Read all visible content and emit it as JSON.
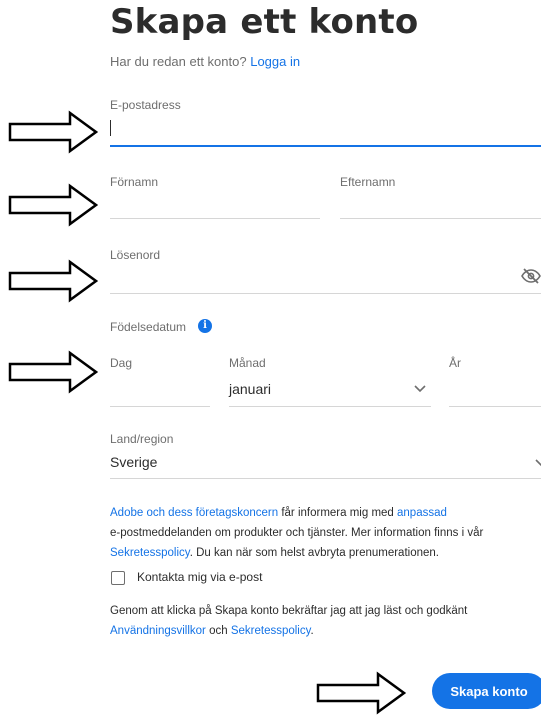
{
  "header": {
    "title": "Skapa ett konto",
    "has_account_text": "Har du redan ett konto?",
    "login_link": "Logga in"
  },
  "form": {
    "email_label": "E-postadress",
    "email_value": "",
    "first_name_label": "Förnamn",
    "last_name_label": "Efternamn",
    "password_label": "Lösenord",
    "birthdate_label": "Födelsedatum",
    "info_icon": "i",
    "day_label": "Dag",
    "month_label": "Månad",
    "month_value": "januari",
    "year_label": "År",
    "country_label": "Land/region",
    "country_value": "Sverige"
  },
  "consent": {
    "part1_link": "Adobe och dess företagskoncern",
    "part2_text": " får informera mig med ",
    "part3_link": "anpassad",
    "line2_text": "e-postmeddelanden om produkter och tjänster. Mer information finns i vår",
    "privacy_link": "Sekretesspolicy",
    "line3_text": ". Du kan när som helst avbryta prenumerationen.",
    "checkbox_label": "Kontakta mig via e-post",
    "terms_text": "Genom att klicka på Skapa konto bekräftar jag att jag läst och godkänt",
    "terms_link": "Användningsvillkor",
    "and_text": " och ",
    "privacy_link2": "Sekretesspolicy",
    "period": "."
  },
  "actions": {
    "submit_label": "Skapa konto"
  },
  "colors": {
    "accent": "#1473e6",
    "text": "#2c2c2c",
    "muted": "#6e6e6e"
  },
  "icons": [
    "eye-off-icon",
    "info-icon",
    "chevron-down-icon",
    "arrow-right-icon"
  ]
}
